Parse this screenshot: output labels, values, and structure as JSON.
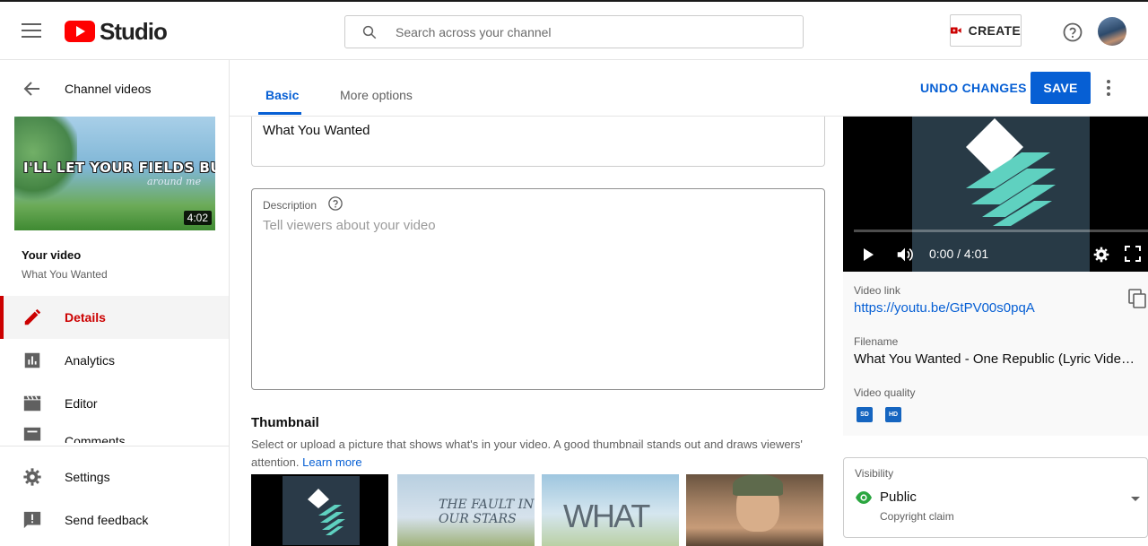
{
  "header": {
    "logo_text": "Studio",
    "search_placeholder": "Search across your channel",
    "create_label": "CREATE"
  },
  "sidebar": {
    "back_label": "Channel videos",
    "thumbnail": {
      "caption_main": "I'LL LET YOUR FIELDS BURN",
      "caption_sub": "around me",
      "duration": "4:02"
    },
    "your_video_label": "Your video",
    "video_title": "What You Wanted",
    "nav_items": [
      {
        "label": "Details",
        "icon": "pencil-icon",
        "active": true
      },
      {
        "label": "Analytics",
        "icon": "analytics-icon"
      },
      {
        "label": "Editor",
        "icon": "clapperboard-icon"
      },
      {
        "label": "Comments",
        "icon": "comments-icon"
      }
    ],
    "bottom_items": [
      {
        "label": "Settings",
        "icon": "gear-icon"
      },
      {
        "label": "Send feedback",
        "icon": "feedback-icon"
      }
    ]
  },
  "tabs": [
    {
      "label": "Basic",
      "active": true
    },
    {
      "label": "More options"
    }
  ],
  "actions": {
    "undo_label": "UNDO CHANGES",
    "save_label": "SAVE"
  },
  "form": {
    "title_value": "What You Wanted",
    "description_label": "Description",
    "description_placeholder": "Tell viewers about your video",
    "thumbnail_heading": "Thumbnail",
    "thumbnail_help": "Select or upload a picture that shows what's in your video. A good thumbnail stands out and draws viewers' attention.",
    "learn_more": "Learn more",
    "thumbnail_options": [
      {
        "text": ""
      },
      {
        "text": "THE FAULT IN OUR STARS"
      },
      {
        "text": "WHAT"
      },
      {
        "text": ""
      }
    ]
  },
  "player": {
    "time": "0:00 / 4:01"
  },
  "video_info": {
    "link_label": "Video link",
    "link_value": "https://youtu.be/GtPV00s0pqA",
    "filename_label": "Filename",
    "filename_value": "What You Wanted - One Republic (Lyric Video) f...",
    "quality_label": "Video quality",
    "quality_badges": [
      "SD",
      "HD"
    ]
  },
  "visibility": {
    "label": "Visibility",
    "value": "Public",
    "sub": "Copyright claim"
  },
  "colors": {
    "accent": "#065fd4",
    "brand_red": "#ff0000",
    "active_nav": "#cc0000",
    "public_green": "#2ba640"
  }
}
